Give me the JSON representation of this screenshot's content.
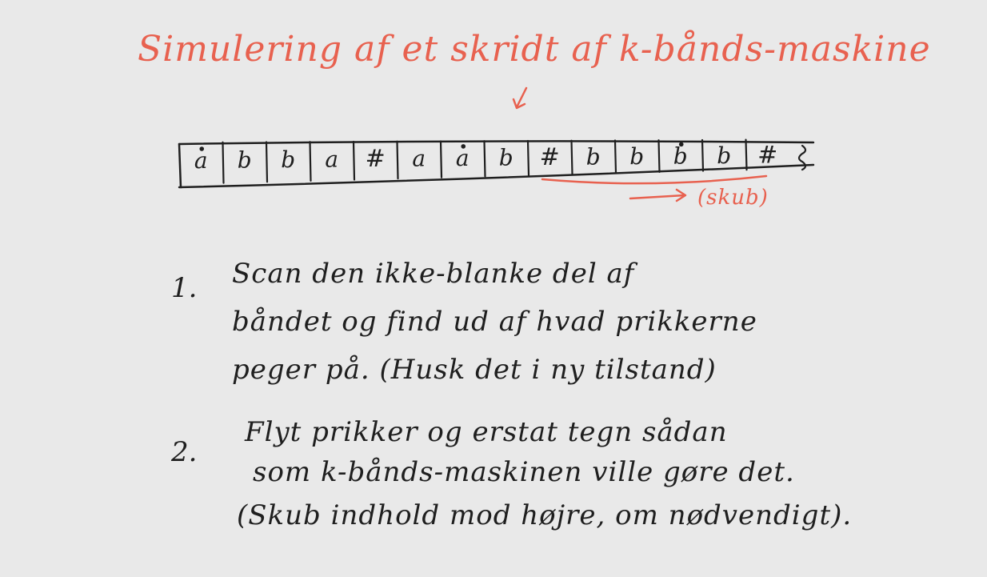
{
  "title": "Simulering af et skridt af k-bånds-maskine",
  "tape": {
    "cells": [
      {
        "symbol": "a",
        "dotted": true
      },
      {
        "symbol": "b",
        "dotted": false
      },
      {
        "symbol": "b",
        "dotted": false
      },
      {
        "symbol": "a",
        "dotted": false
      },
      {
        "symbol": "#",
        "dotted": false
      },
      {
        "symbol": "a",
        "dotted": false
      },
      {
        "symbol": "a",
        "dotted": true
      },
      {
        "symbol": "b",
        "dotted": false
      },
      {
        "symbol": "#",
        "dotted": false
      },
      {
        "symbol": "b",
        "dotted": false
      },
      {
        "symbol": "b",
        "dotted": false
      },
      {
        "symbol": "b",
        "dotted": true
      },
      {
        "symbol": "b",
        "dotted": false
      },
      {
        "symbol": "#",
        "dotted": false
      }
    ]
  },
  "shift_label": "(skub)",
  "steps": [
    {
      "number": "1.",
      "lines": [
        "Scan den ikke-blanke del af",
        "båndet og find ud af hvad prikkerne",
        "peger på. (Husk det i ny tilstand)"
      ]
    },
    {
      "number": "2.",
      "lines": [
        "Flyt prikker og erstat tegn sådan",
        "som k-bånds-maskinen ville gøre det.",
        "(Skub indhold mod højre, om nødvendigt)."
      ]
    }
  ],
  "colors": {
    "accent": "#e8614f",
    "ink": "#1f1f1f",
    "background": "#e9e9e9"
  }
}
